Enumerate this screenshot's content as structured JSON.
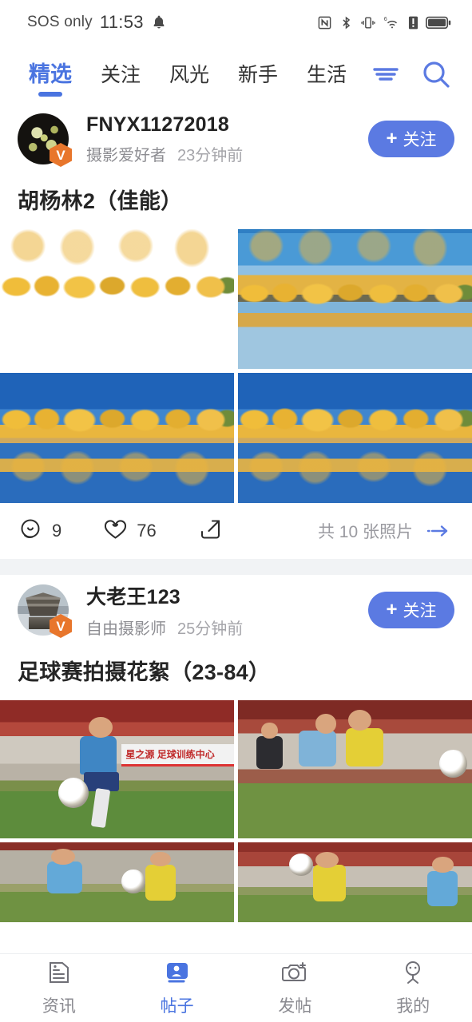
{
  "status_bar": {
    "carrier": "SOS only",
    "time": "11:53",
    "icons": [
      "bell-icon",
      "nfc-icon",
      "bluetooth-icon",
      "vibrate-icon",
      "wifi-6-icon",
      "alert-icon",
      "battery-icon"
    ]
  },
  "header": {
    "tabs": [
      {
        "label": "精选",
        "active": true
      },
      {
        "label": "关注",
        "active": false
      },
      {
        "label": "风光",
        "active": false
      },
      {
        "label": "新手",
        "active": false
      },
      {
        "label": "生活",
        "active": false
      }
    ],
    "menu_icon": "hamburger-menu-icon",
    "search_icon": "search-icon",
    "accent_color": "#4a74e0"
  },
  "posts": [
    {
      "user": {
        "name": "FNYX11272018",
        "role": "摄影爱好者",
        "time": "23分钟前",
        "verified_badge": "V"
      },
      "follow_label": "关注",
      "title": "胡杨林2（佳能）",
      "images": [
        {
          "alt": "金色胡杨林倒映在湖面，蓝天白云"
        },
        {
          "alt": "胡杨林与湖水倒影，远景"
        },
        {
          "alt": "深蓝天空下的胡杨树与水面倒影"
        },
        {
          "alt": "胡杨林湖岸，人群与倒影"
        }
      ],
      "comments": "9",
      "likes": "76",
      "share_icon": "share-icon",
      "photo_count_label": "共 10 张照片",
      "goto_icon": "arrow-right-icon"
    },
    {
      "user": {
        "name": "大老王123",
        "role": "自由摄影师",
        "time": "25分钟前",
        "verified_badge": "V"
      },
      "follow_label": "关注",
      "title": "足球赛拍摄花絮（23-84）",
      "images": [
        {
          "alt": "蓝衣球员控球，背景星之源训练中心横幅",
          "banner_text": "星之源 足球训练中心"
        },
        {
          "alt": "浅蓝与黄色球衣球员争抢"
        },
        {
          "alt": "蓝衣球员射门，黄衣球员站立"
        },
        {
          "alt": "黄色13号球员头球，看台背景"
        }
      ]
    }
  ],
  "bottom_nav": [
    {
      "label": "资讯",
      "icon": "news-icon",
      "active": false
    },
    {
      "label": "帖子",
      "icon": "posts-icon",
      "active": true
    },
    {
      "label": "发帖",
      "icon": "camera-plus-icon",
      "active": false
    },
    {
      "label": "我的",
      "icon": "profile-icon",
      "active": false
    }
  ],
  "colors": {
    "accent": "#4a74e0",
    "follow_button": "#5b7ae2",
    "badge": "#e8762c",
    "divider": "#f1f3f5"
  }
}
